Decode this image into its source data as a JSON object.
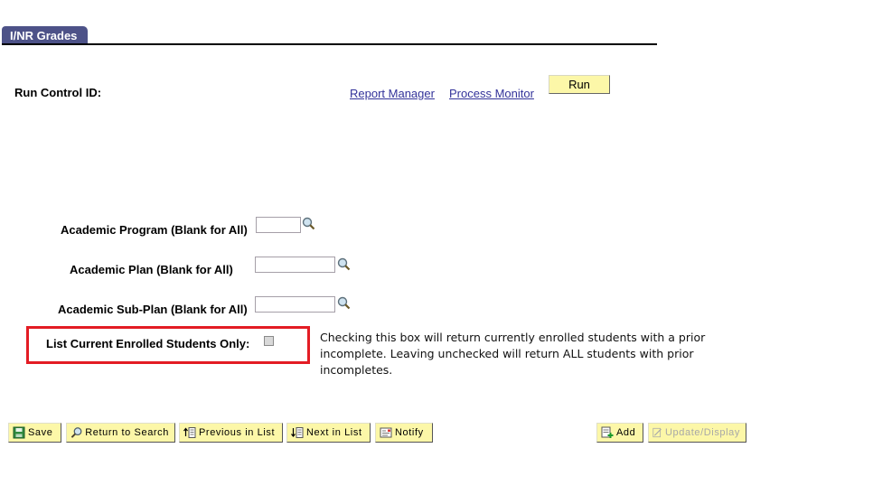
{
  "tab": {
    "label": "I/NR Grades"
  },
  "run_control": {
    "label": "Run Control ID:",
    "value": "",
    "report_manager_link": "Report Manager",
    "process_monitor_link": "Process Monitor",
    "run_button": "Run"
  },
  "fields": [
    {
      "label": "Academic Program (Blank for All)",
      "value": "",
      "lookup_icon": "magnifier-icon"
    },
    {
      "label": "Academic Plan (Blank for All)",
      "value": "",
      "lookup_icon": "magnifier-icon"
    },
    {
      "label": "Academic Sub-Plan (Blank for All)",
      "value": "",
      "lookup_icon": "magnifier-icon"
    }
  ],
  "checkbox": {
    "label": "List Current Enrolled Students Only:",
    "checked": false,
    "highlight_color": "#e31c24"
  },
  "note": {
    "line1": "Checking this box will return currently enrolled students with a prior",
    "line2": "incomplete.  Leaving unchecked will return ALL students with prior",
    "line3": "incompletes."
  },
  "toolbar": {
    "save": {
      "label": "Save",
      "icon": "save-icon"
    },
    "return_to_search": {
      "label": "Return to Search",
      "icon": "search-icon"
    },
    "previous_in_list": {
      "label": "Previous in List",
      "icon": "previous-icon"
    },
    "next_in_list": {
      "label": "Next in List",
      "icon": "next-icon"
    },
    "notify": {
      "label": "Notify",
      "icon": "notify-icon"
    },
    "add": {
      "label": "Add",
      "icon": "add-icon"
    },
    "update_display": {
      "label": "Update/Display",
      "icon": "update-icon",
      "disabled": true
    }
  },
  "colors": {
    "tab_bg": "#4d5288",
    "button_bg": "#fcf7a8",
    "link": "#33339a"
  }
}
